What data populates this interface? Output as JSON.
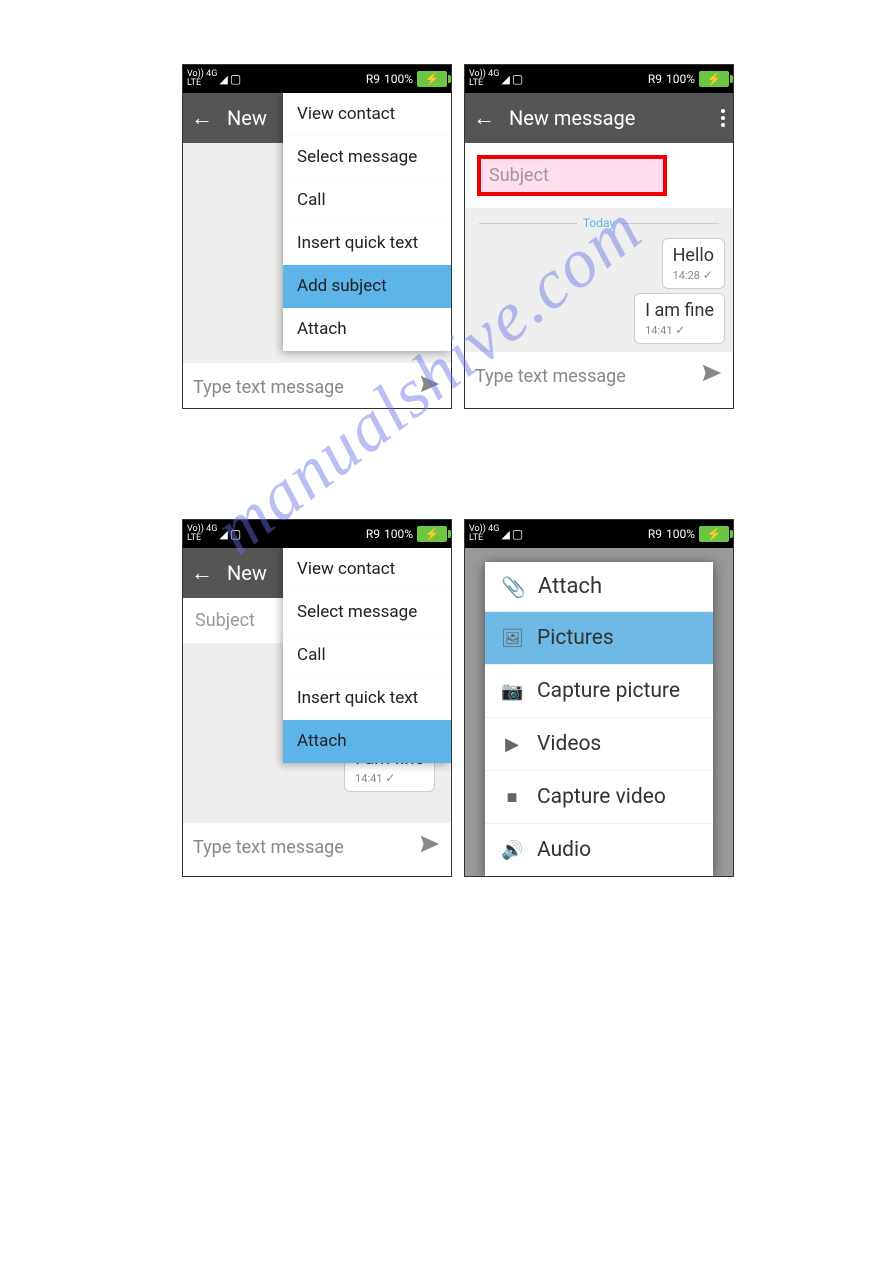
{
  "watermark": "manualshive.com",
  "status": {
    "net": "Vo)) 4G",
    "lte": "LTE",
    "sig_extra": "4G",
    "roam": "R9",
    "battery_pct": "100%"
  },
  "appbar": {
    "title_short": "New",
    "title_full": "New message"
  },
  "subject": {
    "placeholder": "Subject"
  },
  "chat": {
    "today": "Today",
    "msg1": {
      "text": "Hello",
      "time": "14:28"
    },
    "msg2": {
      "text": "I am fine",
      "time": "14:41"
    }
  },
  "input": {
    "placeholder": "Type text message"
  },
  "menu": {
    "view_contact": "View contact",
    "select_message": "Select message",
    "call": "Call",
    "insert_quick_text": "Insert quick text",
    "add_subject": "Add subject",
    "attach": "Attach"
  },
  "attach_dialog": {
    "title": "Attach",
    "pictures": "Pictures",
    "capture_picture": "Capture picture",
    "videos": "Videos",
    "capture_video": "Capture video",
    "audio": "Audio"
  }
}
